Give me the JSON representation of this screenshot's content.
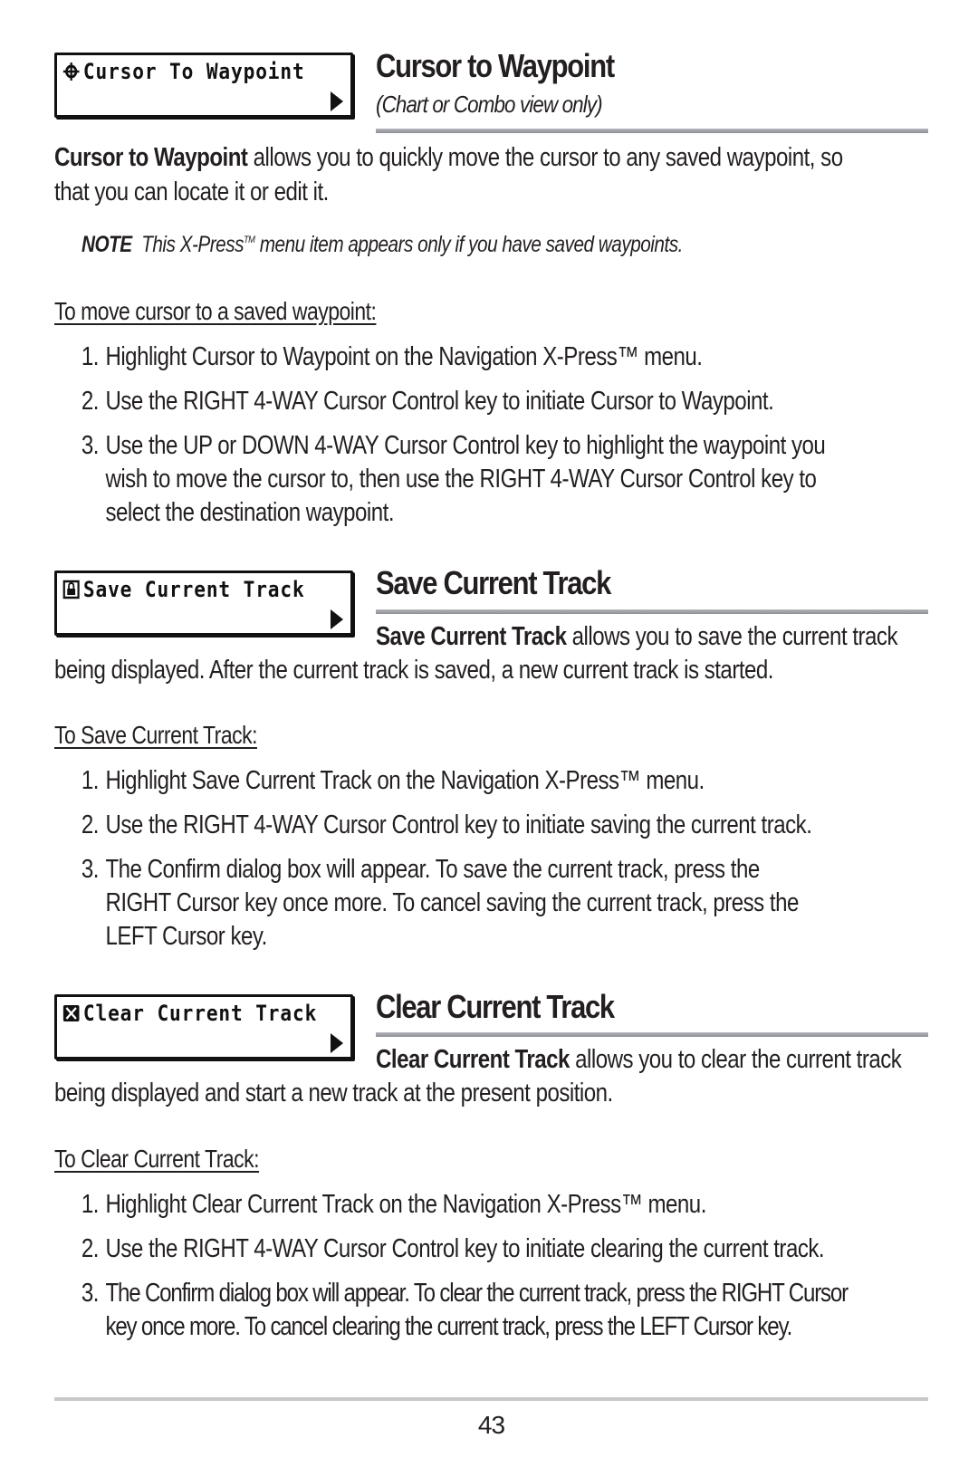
{
  "sections": [
    {
      "menu_label": "Cursor To Waypoint",
      "menu_icon": "crosshair-icon",
      "title": "Cursor to Waypoint",
      "subtitle": "(Chart or Combo view only)",
      "intro_bold": "Cursor to Waypoint",
      "intro_rest_line1": " allows you to quickly move the cursor to any saved waypoint, so",
      "intro_line2": "that you can locate it or edit it.",
      "note_label": "NOTE",
      "note_pre": "This X-Press",
      "note_tm": "TM",
      "note_post": " menu item appears only if you have saved waypoints.",
      "procedure_title": "To move cursor to a saved waypoint:",
      "steps": [
        {
          "num": "1.",
          "lines": [
            "Highlight Cursor to Waypoint on the Navigation X-Press™ menu."
          ]
        },
        {
          "num": "2.",
          "lines": [
            "Use the RIGHT 4-WAY Cursor Control key to initiate Cursor to Waypoint."
          ]
        },
        {
          "num": "3.",
          "lines": [
            "Use the UP or DOWN 4-WAY Cursor Control key to highlight the waypoint you",
            "wish to move the cursor to, then use the RIGHT 4-WAY Cursor Control key to",
            "select the destination waypoint."
          ]
        }
      ]
    },
    {
      "menu_label": "Save Current Track",
      "menu_icon": "save-lock-icon",
      "title": "Save Current Track",
      "intro_bold": "Save Current Track",
      "intro_rest_line1": " allows you to save the current track",
      "intro_line2": "being displayed. After the current track is saved, a new current track is started.",
      "procedure_title": "To Save Current Track:",
      "steps": [
        {
          "num": "1.",
          "lines": [
            "Highlight Save Current Track on the Navigation X-Press™ menu."
          ]
        },
        {
          "num": "2.",
          "lines": [
            "Use the RIGHT 4-WAY Cursor Control key to initiate saving the current track."
          ]
        },
        {
          "num": "3.",
          "lines": [
            "The Confirm dialog box will appear. To save the current track,  press the",
            "RIGHT Cursor key once more. To cancel saving the current track, press the",
            "LEFT Cursor key."
          ]
        }
      ]
    },
    {
      "menu_label": "Clear Current Track",
      "menu_icon": "clear-x-icon",
      "title": "Clear Current Track",
      "intro_bold": "Clear Current Track",
      "intro_rest_line1": " allows you to clear the current track",
      "intro_line2": "being displayed and start a new track at the present position.",
      "procedure_title": "To Clear Current Track:",
      "steps": [
        {
          "num": "1.",
          "lines": [
            "Highlight Clear Current Track on the Navigation X-Press™ menu."
          ]
        },
        {
          "num": "2.",
          "lines": [
            "Use the RIGHT 4-WAY Cursor Control key to initiate clearing the current track."
          ]
        },
        {
          "num": "3.",
          "lines": [
            "The Confirm dialog box will appear. To clear the current track, press the RIGHT Cursor",
            "key once more. To cancel clearing the current track, press the LEFT Cursor key."
          ]
        }
      ]
    }
  ],
  "page_number": "43",
  "colors": {
    "text": "#231f20",
    "rule": "#9a9ba0",
    "footer_rule": "#c8c8c8"
  }
}
